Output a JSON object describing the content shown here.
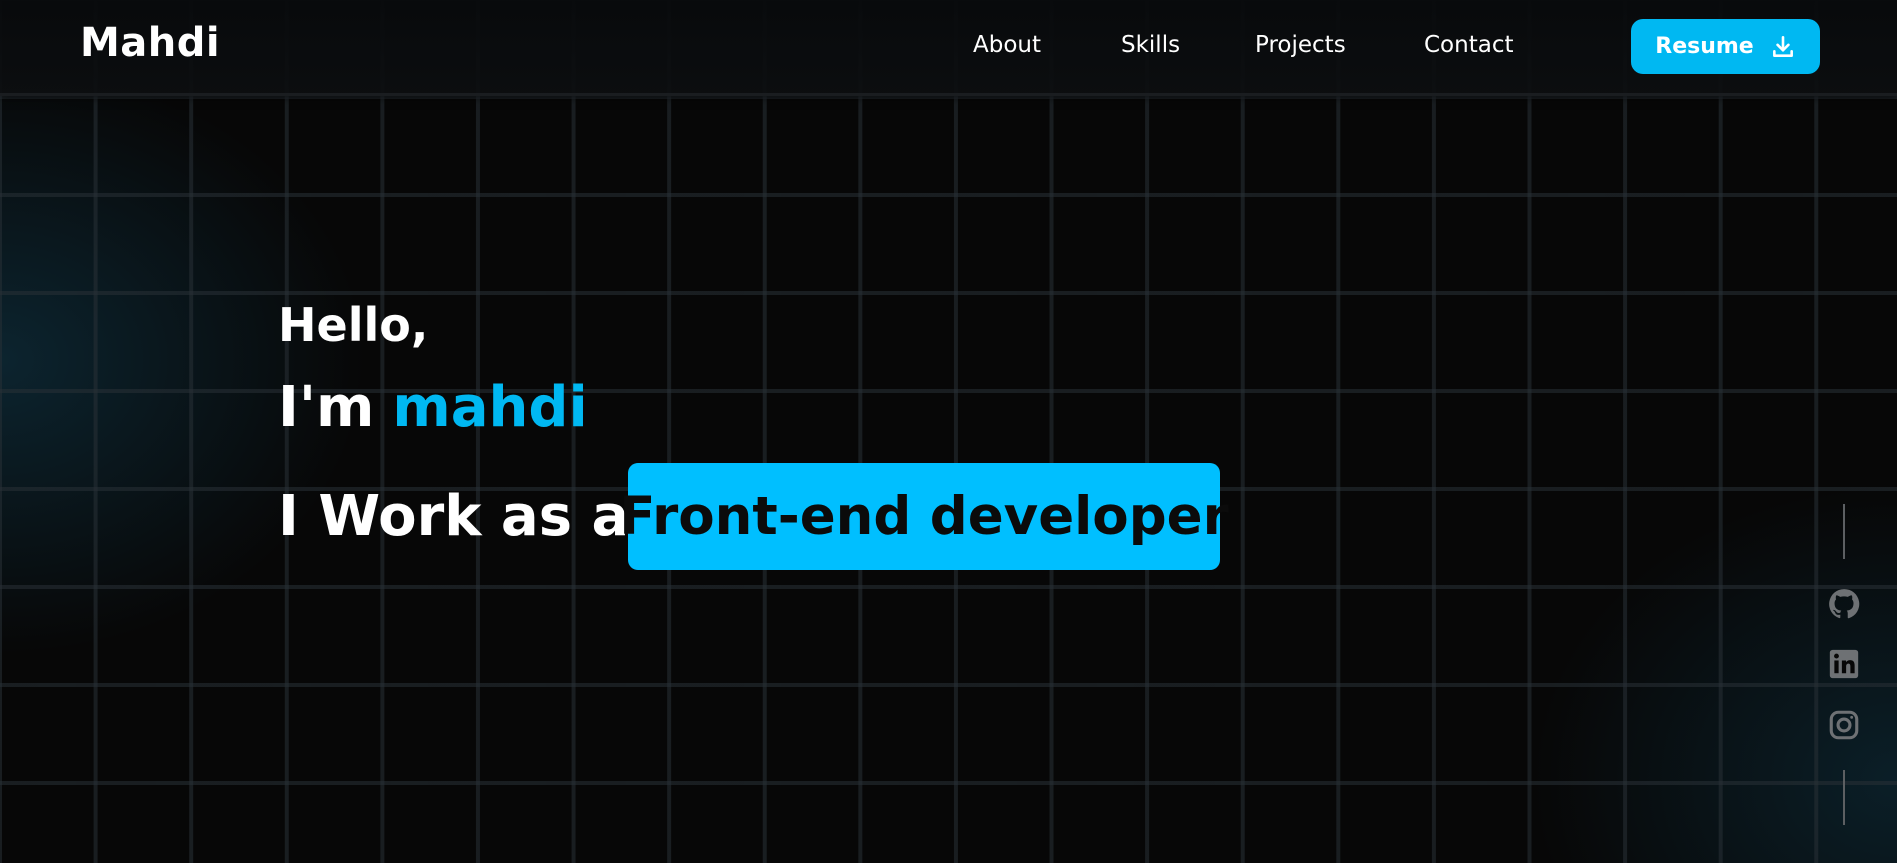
{
  "header": {
    "logo": "Mahdi",
    "nav": [
      "About",
      "Skills",
      "Projects",
      "Contact"
    ],
    "resume_label": "Resume",
    "resume_icon": "download-icon"
  },
  "hero": {
    "greeting": "Hello,",
    "intro_prefix": "I'm",
    "name": "mahdi",
    "work_prefix": "I Work as a",
    "role": "Front-end developer"
  },
  "social": {
    "icons": [
      "github-icon",
      "linkedin-icon",
      "instagram-icon"
    ]
  },
  "colors": {
    "accent": "#00b8f2",
    "background": "#070707",
    "text": "#ffffff",
    "social_icon": "#6e7174"
  }
}
